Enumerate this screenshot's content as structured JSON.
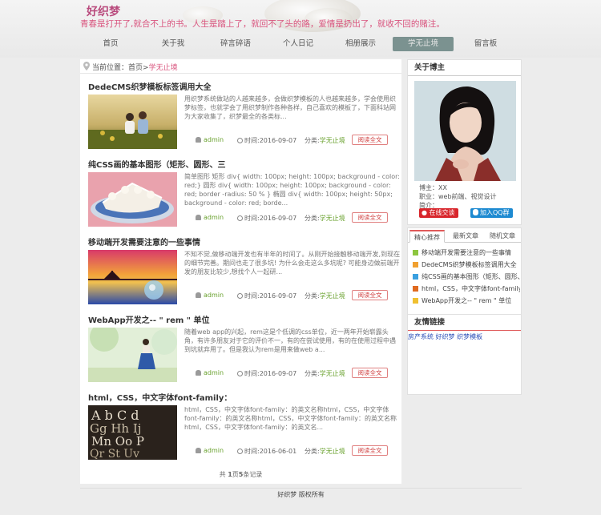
{
  "site": {
    "logo": "好织梦",
    "slogan": "青春是打开了,就合不上的书。人生是踏上了，就回不了头的路，爱情是扔出了，就收不回的赌注。"
  },
  "nav": [
    "首页",
    "关于我",
    "碎言碎语",
    "个人日记",
    "相册展示",
    "学无止境",
    "留言板"
  ],
  "nav_active": "学无止境",
  "breadcrumb": {
    "prefix": "当前位置：",
    "home": "首页",
    "sep": ">",
    "current": "学无止境"
  },
  "articles": [
    {
      "title": "DedeCMS织梦模板标签调用大全",
      "desc": "用织梦系统做站的人越来越多，会做织梦模板的人也越来越多，学会使用织梦标签，也就学会了用织梦制作各种各样，自己喜欢的模板了，下面科站网为大家收集了，织梦最全的各类标...",
      "author": "admin",
      "time": "时间:2016-09-07",
      "cat_label": "分类:",
      "cat": "学无止境",
      "read": "阅读全文",
      "thumb": "kids"
    },
    {
      "title": "纯CSS画的基本图形（矩形、圆形、三",
      "desc": "简单图形 矩形 div{ width: 100px; height: 100px; background - color: red;} 圆形 div{ width: 100px; height: 100px; background - color: red; border -radius: 50 % } 椭圆 div{ width: 100px; height: 50px; background - color: red; borde...",
      "author": "admin",
      "time": "时间:2016-09-07",
      "cat_label": "分类:",
      "cat": "学无止境",
      "read": "阅读全文",
      "thumb": "cake"
    },
    {
      "title": "移动端开发需要注意的一些事情",
      "desc": "不知不觉,做移动端开发也有半年的时间了。从刚开始接触移动端开发,到现在的细节完善。期间也走了很多坑! 为什么会走这么多坑呢? 可能身边做前端开发的朋友比较少,想找个人一起研...",
      "author": "admin",
      "time": "时间:2016-09-07",
      "cat_label": "分类:",
      "cat": "学无止境",
      "read": "阅读全文",
      "thumb": "sunset"
    },
    {
      "title": "WebApp开发之-- \" rem \" 单位",
      "desc": "随着web app的兴起，rem这是个低调的css单位，近一两年开始崭露头角，有许多朋友对于它的评价不一，有的在尝试使用，有的在使用过程中遇到坑就弃用了。但是我认为rem是用来做web a...",
      "author": "admin",
      "time": "时间:2016-09-07",
      "cat_label": "分类:",
      "cat": "学无止境",
      "read": "阅读全文",
      "thumb": "girl"
    },
    {
      "title": "html，CSS，中文字体font-family：",
      "desc": "html，CSS，中文字体font-family：的英文名称html，CSS，中文字体font-family：的英文名称html，CSS，中文字体font-family：的英文名称html，CSS，中文字体font-family：的英文名...",
      "author": "admin",
      "time": "时间:2016-06-01",
      "cat_label": "分类:",
      "cat": "学无止境",
      "read": "阅读全文",
      "thumb": "letters"
    }
  ],
  "pager": {
    "prefix": "共 ",
    "pages": "1",
    "mid": "页",
    "count": "5",
    "suffix": "条记录"
  },
  "about": {
    "title": "关于博主",
    "blogger": "博主：XX",
    "job": "职业：web前端、视觉设计",
    "intro": "简介：",
    "weibo": "在线交谈",
    "qq": "加入QQ群"
  },
  "tabs": {
    "items": [
      "精心推荐",
      "最新文章",
      "随机文章"
    ],
    "active": "精心推荐"
  },
  "recommend": [
    {
      "text": "移动端开发需要注意的一些事情",
      "color": "#8dc63f"
    },
    {
      "text": "DedeCMS织梦模板标签调用大全",
      "color": "#f0a030"
    },
    {
      "text": "纯CSS画的基本图形（矩形、圆形、",
      "color": "#3aa0e0"
    },
    {
      "text": "html，CSS，中文字体font-family：",
      "color": "#e06a20"
    },
    {
      "text": "WebApp开发之-- \" rem \" 单位",
      "color": "#f0c030"
    }
  ],
  "links": {
    "title": "友情链接",
    "items": [
      "房产系统",
      "好织梦",
      "织梦模板"
    ]
  },
  "footer": "好织梦 版权所有"
}
